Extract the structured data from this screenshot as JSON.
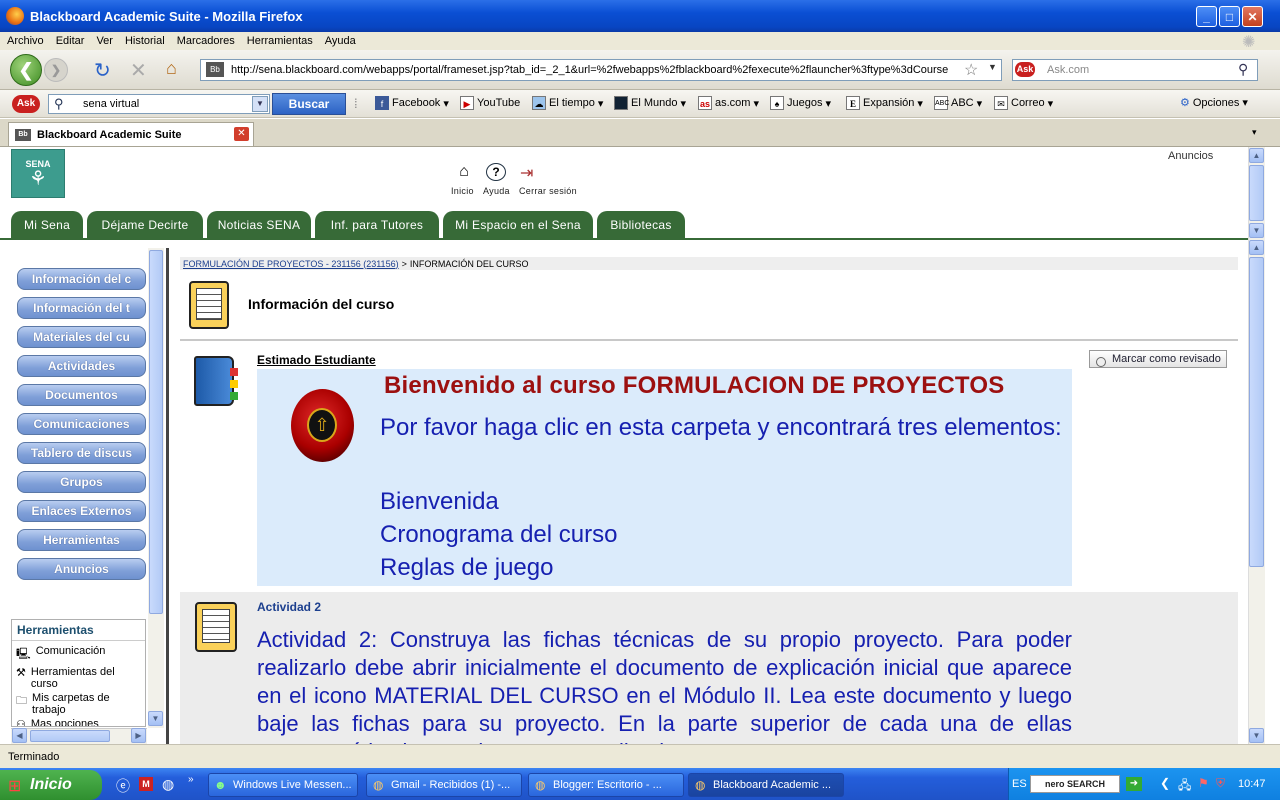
{
  "window": {
    "title": "Blackboard Academic Suite - Mozilla Firefox"
  },
  "menu": [
    "Archivo",
    "Editar",
    "Ver",
    "Historial",
    "Marcadores",
    "Herramientas",
    "Ayuda"
  ],
  "nav": {
    "url": "http://sena.blackboard.com/webapps/portal/frameset.jsp?tab_id=_2_1&url=%2fwebapps%2fblackboard%2fexecute%2flauncher%3ftype%3dCourse",
    "ask_placeholder": "Ask.com"
  },
  "search": {
    "value": "sena virtual",
    "button": "Buscar"
  },
  "bookmarks": [
    "Facebook",
    "YouTube",
    "El tiempo",
    "El Mundo",
    "as.com",
    "Juegos",
    "Expansión",
    "ABC",
    "Correo",
    "Opciones"
  ],
  "tab": {
    "label": "Blackboard Academic Suite"
  },
  "header": {
    "logo": "SENA",
    "anuncios": "Anuncios",
    "links": [
      "Inicio",
      "Ayuda",
      "Cerrar sesión"
    ]
  },
  "nav_tabs": [
    "Mi Sena",
    "Déjame Decirte",
    "Noticias SENA",
    "Inf. para Tutores",
    "Mi Espacio en el Sena",
    "Bibliotecas"
  ],
  "left_buttons": [
    "Información del c",
    "Información del t",
    "Materiales del cu",
    "Actividades",
    "Documentos",
    "Comunicaciones",
    "Tablero de discus",
    "Grupos",
    "Enlaces Externos",
    "Herramientas",
    "Anuncios"
  ],
  "tools": {
    "title": "Herramientas",
    "items": [
      "Comunicación",
      "Herramientas del curso",
      "Mis carpetas de trabajo",
      "Mas opciones"
    ]
  },
  "breadcrumb": {
    "course": "FORMULACIÓN DE PROYECTOS - 231156 (231156)",
    "sep": ">",
    "current": "INFORMACIÓN DEL CURSO"
  },
  "page_title": "Información del curso",
  "item1": {
    "title": "Estimado Estudiante",
    "mark": "Marcar como revisado",
    "heading": "Bienvenido al curso FORMULACION DE PROYECTOS",
    "intro": "Por favor haga clic en esta carpeta y encontrará tres elementos:",
    "list": [
      "Bienvenida",
      "Cronograma del curso",
      "Reglas de juego"
    ]
  },
  "item2": {
    "title": "Actividad 2",
    "text": "Actividad 2: Construya las fichas técnicas de su propio proyecto. Para poder realizarlo debe abrir inicialmente el documento de explicación inicial que aparece en el icono MATERIAL DEL CURSO en el Módulo II. Lea este documento y luego baje las fichas para su proyecto. En la parte superior de cada una de ellas encontrará las instrucciones para realizarlas; esto es muy"
  },
  "status": "Terminado",
  "taskbar": {
    "start": "Inicio",
    "tasks": [
      "Windows Live Messen...",
      "Gmail - Recibidos (1) -...",
      "Blogger: Escritorio - ...",
      "Blackboard Academic ..."
    ],
    "lang": "ES",
    "nero": "nero SEARCH",
    "clock": "10:47"
  }
}
